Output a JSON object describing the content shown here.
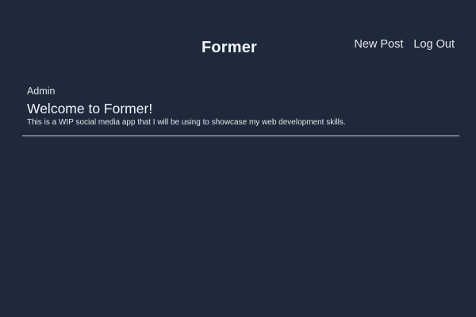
{
  "header": {
    "brand": "Former",
    "nav": {
      "new_post": "New Post",
      "log_out": "Log Out"
    }
  },
  "feed": {
    "posts": [
      {
        "author": "Admin",
        "title": "Welcome to Former!",
        "body": "This is a WIP social media app that I will be using to showcase my web development skills."
      }
    ]
  },
  "colors": {
    "background": "#1e293b",
    "text": "#e5e7eb",
    "divider": "#cbd5e1"
  }
}
